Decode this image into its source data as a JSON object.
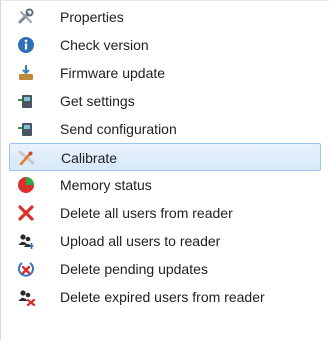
{
  "menu": {
    "items": [
      {
        "label": "Properties",
        "icon": "tools-icon"
      },
      {
        "label": "Check version",
        "icon": "info-icon"
      },
      {
        "label": "Firmware update",
        "icon": "firmware-icon"
      },
      {
        "label": "Get settings",
        "icon": "device-icon"
      },
      {
        "label": "Send configuration",
        "icon": "device-icon"
      },
      {
        "label": "Calibrate",
        "icon": "calibrate-icon"
      },
      {
        "label": "Memory status",
        "icon": "pie-chart-icon"
      },
      {
        "label": "Delete all users from reader",
        "icon": "delete-x-icon"
      },
      {
        "label": "Upload all users to reader",
        "icon": "users-upload-icon"
      },
      {
        "label": "Delete pending updates",
        "icon": "pending-delete-icon"
      },
      {
        "label": "Delete expired users from reader",
        "icon": "users-delete-icon"
      }
    ],
    "highlighted_index": 5,
    "colors": {
      "highlight_bg": "#dceaf9",
      "highlight_border": "#9ec3ea",
      "text": "#1e1e1e"
    }
  }
}
